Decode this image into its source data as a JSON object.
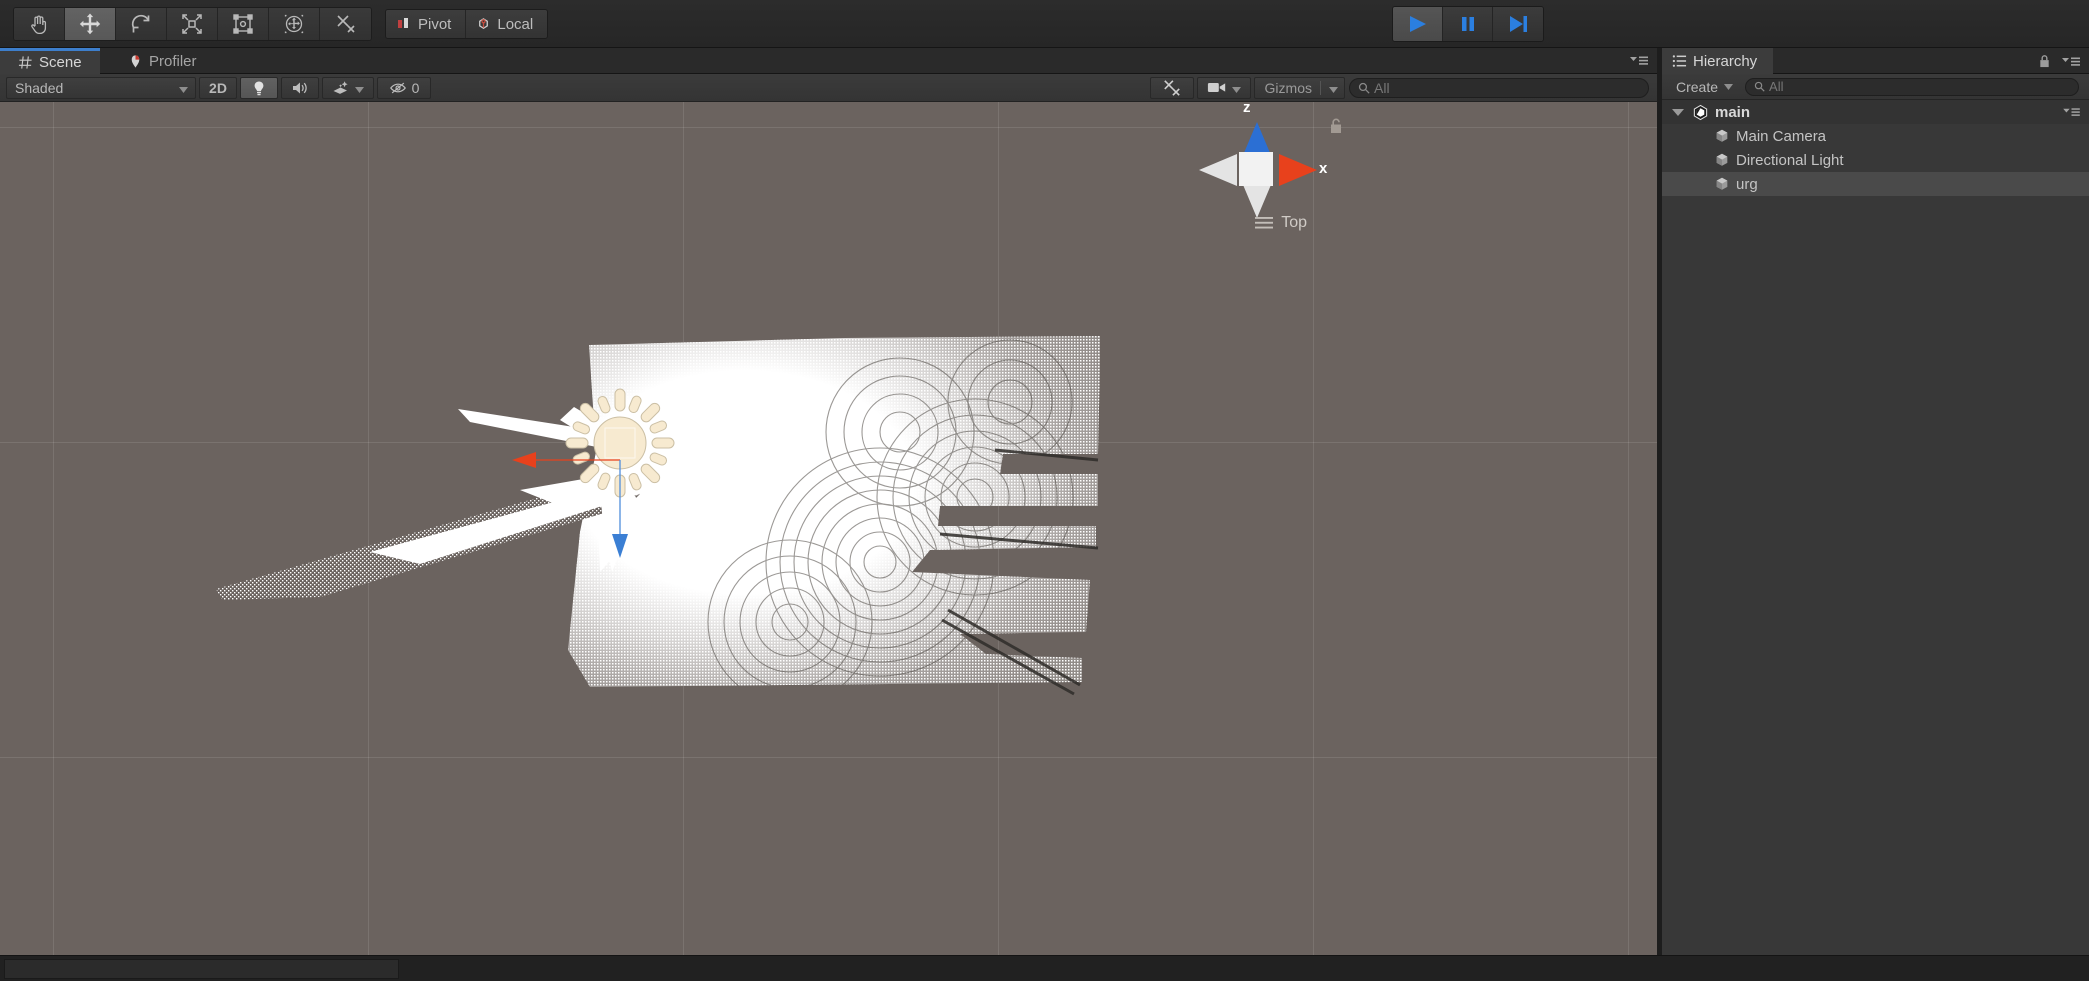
{
  "toolbar": {
    "tools": [
      {
        "name": "hand-tool",
        "label": "Hand",
        "active": false
      },
      {
        "name": "move-tool",
        "label": "Move",
        "active": true
      },
      {
        "name": "rotate-tool",
        "label": "Rotate",
        "active": false
      },
      {
        "name": "scale-tool",
        "label": "Scale",
        "active": false
      },
      {
        "name": "rect-tool",
        "label": "Rect Transform",
        "active": false
      },
      {
        "name": "transform-tool",
        "label": "Transform",
        "active": false
      },
      {
        "name": "custom-tool",
        "label": "Custom Editor Tool",
        "active": false
      }
    ],
    "pivot_mode": "Pivot",
    "pivot_rotation": "Local",
    "play": "Play",
    "pause": "Pause",
    "step": "Step"
  },
  "tabs": [
    {
      "label": "Scene",
      "icon": "grid-icon",
      "active": true
    },
    {
      "label": "Profiler",
      "icon": "profiler-icon",
      "active": false
    }
  ],
  "scene_toolbar": {
    "draw_mode": "Shaded",
    "mode_2d": "2D",
    "lighting": "Lighting",
    "audio": "Audio",
    "effects": "Effects",
    "hidden_count": "0",
    "tools": "Component Tools",
    "camera": "Scene Camera",
    "gizmos": "Gizmos",
    "search_placeholder": "All",
    "search_value": ""
  },
  "scene_view": {
    "orientation": "Top",
    "axis_x": "x",
    "axis_z": "z",
    "locked": false,
    "background_color": "#6b635f",
    "point_color": "#ffffff",
    "selected_object": "Directional Light"
  },
  "hierarchy": {
    "title": "Hierarchy",
    "create_label": "Create",
    "search_placeholder": "All",
    "search_value": "",
    "items": [
      {
        "label": "main",
        "depth": 0,
        "icon": "unity-scene-icon",
        "selected": false,
        "expanded": true
      },
      {
        "label": "Main Camera",
        "depth": 1,
        "icon": "gameobject-icon",
        "selected": false
      },
      {
        "label": "Directional Light",
        "depth": 1,
        "icon": "gameobject-icon",
        "selected": false
      },
      {
        "label": "urg",
        "depth": 1,
        "icon": "gameobject-icon",
        "selected": true
      }
    ]
  },
  "colors": {
    "accent_blue": "#3d7ecb",
    "axis_x_red": "#e8411c",
    "axis_z_blue": "#2b6fd4",
    "panel_bg": "#3c3c3c",
    "toolbar_bg": "#2c2c2c",
    "viewport_bg": "#6b635f",
    "light_gizmo": "#f6e6c4"
  }
}
